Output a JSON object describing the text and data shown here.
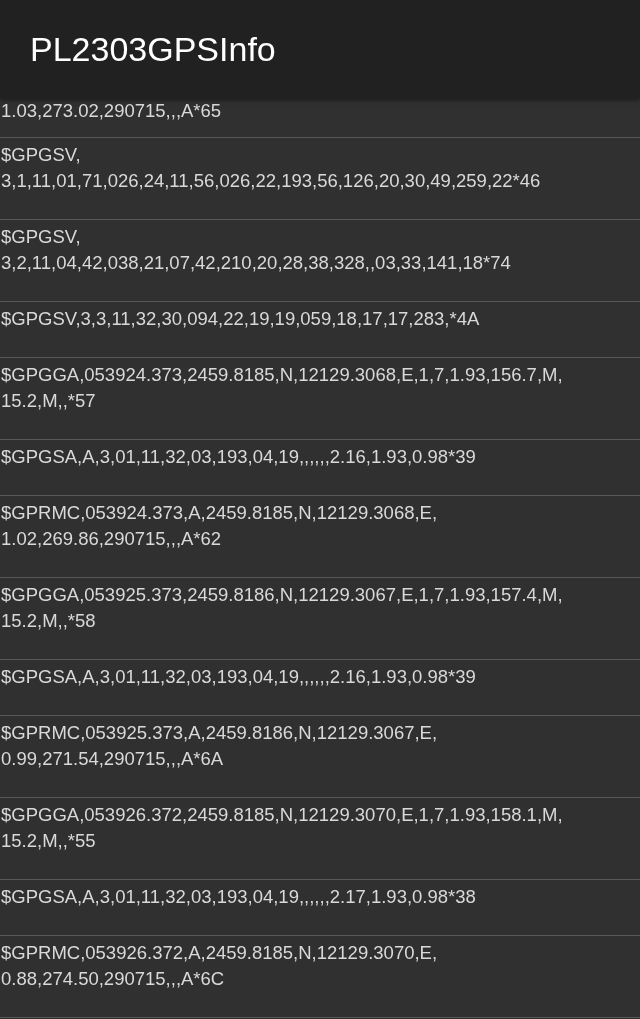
{
  "app_bar": {
    "title": "PL2303GPSInfo"
  },
  "messages": [
    {
      "text": "1.03,273.02,290715,,,A*65"
    },
    {
      "text": "$GPGSV,\n3,1,11,01,71,026,24,11,56,026,22,193,56,126,20,30,49,259,22*46"
    },
    {
      "text": "$GPGSV,\n3,2,11,04,42,038,21,07,42,210,20,28,38,328,,03,33,141,18*74"
    },
    {
      "text": "$GPGSV,3,3,11,32,30,094,22,19,19,059,18,17,17,283,*4A"
    },
    {
      "text": "$GPGGA,053924.373,2459.8185,N,12129.3068,E,1,7,1.93,156.7,M,\n15.2,M,,*57"
    },
    {
      "text": "$GPGSA,A,3,01,11,32,03,193,04,19,,,,,,2.16,1.93,0.98*39"
    },
    {
      "text": "$GPRMC,053924.373,A,2459.8185,N,12129.3068,E,\n1.02,269.86,290715,,,A*62"
    },
    {
      "text": "$GPGGA,053925.373,2459.8186,N,12129.3067,E,1,7,1.93,157.4,M,\n15.2,M,,*58"
    },
    {
      "text": "$GPGSA,A,3,01,11,32,03,193,04,19,,,,,,2.16,1.93,0.98*39"
    },
    {
      "text": "$GPRMC,053925.373,A,2459.8186,N,12129.3067,E,\n0.99,271.54,290715,,,A*6A"
    },
    {
      "text": "$GPGGA,053926.372,2459.8185,N,12129.3070,E,1,7,1.93,158.1,M,\n15.2,M,,*55"
    },
    {
      "text": "$GPGSA,A,3,01,11,32,03,193,04,19,,,,,,2.17,1.93,0.98*38"
    },
    {
      "text": "$GPRMC,053926.372,A,2459.8185,N,12129.3070,E,\n0.88,274.50,290715,,,A*6C"
    }
  ]
}
